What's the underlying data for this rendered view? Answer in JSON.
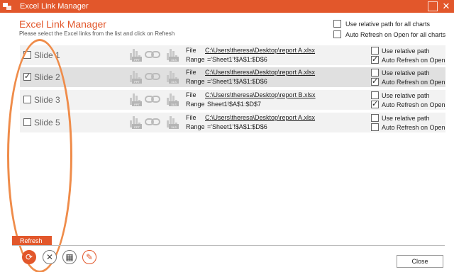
{
  "window": {
    "title": "Excel Link Manager"
  },
  "heading": "Excel Link Manager",
  "subheading": "Please select the Excel links from the list and click on Refresh",
  "global_options": {
    "relative_all": {
      "label": "Use relative path for all charts",
      "checked": false
    },
    "auto_all": {
      "label": "Auto Refresh on Open for all charts",
      "checked": false
    }
  },
  "labels": {
    "file": "File",
    "range": "Range",
    "use_relative": "Use relative path",
    "auto_refresh": "Auto Refresh on Open",
    "ppt": "PPT",
    "xls": "XLS"
  },
  "rows": [
    {
      "slide": "Slide 1",
      "checked": false,
      "file": "C:\\Users\\theresa\\Desktop\\report A.xlsx",
      "range": "='Sheet1'!$A$1:$D$6",
      "relative": false,
      "auto": true
    },
    {
      "slide": "Slide 2",
      "checked": true,
      "file": "C:\\Users\\theresa\\Desktop\\report A.xlsx",
      "range": "='Sheet1'!$A$1:$D$6",
      "relative": false,
      "auto": true
    },
    {
      "slide": "Slide 3",
      "checked": false,
      "file": "C:\\Users\\theresa\\Desktop\\report B.xlsx",
      "range": "Sheet1!$A$1:$D$7",
      "relative": false,
      "auto": true
    },
    {
      "slide": "Slide 5",
      "checked": false,
      "file": "C:\\Users\\theresa\\Desktop\\report A.xlsx",
      "range": "='Sheet1'!$A$1:$D$6",
      "relative": false,
      "auto": false
    }
  ],
  "footer": {
    "refresh_label": "Refresh",
    "close_label": "Close"
  },
  "colors": {
    "accent": "#e2572b",
    "highlight": "#ef8c4a"
  }
}
